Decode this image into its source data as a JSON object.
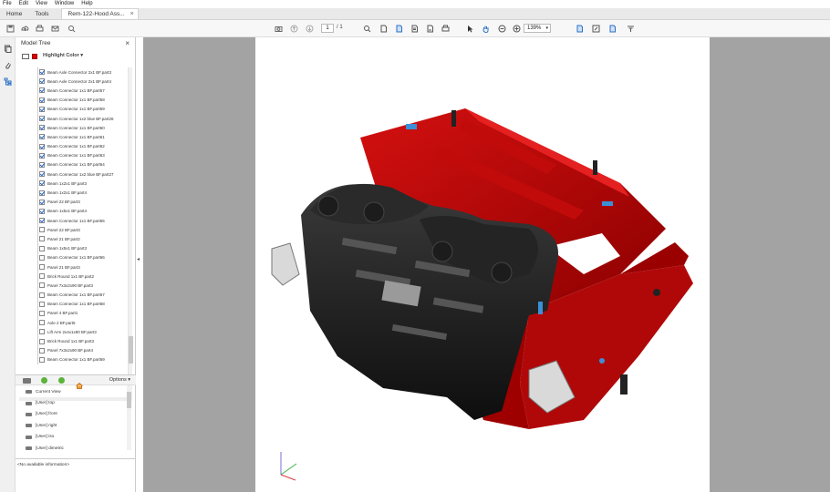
{
  "menu": [
    "File",
    "Edit",
    "View",
    "Window",
    "Help"
  ],
  "tabs": {
    "home": "Home",
    "tools": "Tools",
    "document": "Rem-122-Hood Ass..."
  },
  "toolbar": {
    "page_current": "1",
    "page_total": "/ 1",
    "zoom": "139%"
  },
  "model_tree": {
    "title": "Model Tree",
    "highlight_label": "Highlight Color",
    "highlight_color": "#e00000",
    "items": [
      {
        "label": "Beam Axle Connector 2x1 BF.part3",
        "checked": true
      },
      {
        "label": "Beam Axle Connector 2x1 BF.part4",
        "checked": true
      },
      {
        "label": "Beam Connector 1x1 BF.part57",
        "checked": true
      },
      {
        "label": "Beam Connector 1x1 BF.part58",
        "checked": true
      },
      {
        "label": "Beam Connector 1x1 BF.part59",
        "checked": true
      },
      {
        "label": "Beam Connector 1x2 blue BF.part26",
        "checked": true
      },
      {
        "label": "Beam Connector 1x1 BF.part60",
        "checked": true
      },
      {
        "label": "Beam Connector 1x1 BF.part61",
        "checked": true
      },
      {
        "label": "Beam Connector 1x1 BF.part62",
        "checked": true
      },
      {
        "label": "Beam Connector 1x1 BF.part63",
        "checked": true
      },
      {
        "label": "Beam Connector 1x1 BF.part64",
        "checked": true
      },
      {
        "label": "Beam Connector 1x2 blue BF.part27",
        "checked": true
      },
      {
        "label": "Beam 1x2x1 BF.part3",
        "checked": true
      },
      {
        "label": "Beam 1x2x1 BF.part4",
        "checked": true
      },
      {
        "label": "Panel 22 BF.part3",
        "checked": true
      },
      {
        "label": "Beam 1x5x1 BF.part4",
        "checked": true
      },
      {
        "label": "Beam Connector 1x1 BF.part65",
        "checked": true
      },
      {
        "label": "Panel 22 BF.part3",
        "checked": false
      },
      {
        "label": "Panel 21 BF.part2",
        "checked": false
      },
      {
        "label": "Beam 1x5x1 BF.part3",
        "checked": false
      },
      {
        "label": "Beam Connector 1x1 BF.part66",
        "checked": false
      },
      {
        "label": "Panel 21 BF.part3",
        "checked": false
      },
      {
        "label": "Brick Round 1x1 BF.part2",
        "checked": false
      },
      {
        "label": "Panel 7x3x2x90 BF.part3",
        "checked": false
      },
      {
        "label": "Beam Connector 1x1 BF.part67",
        "checked": false
      },
      {
        "label": "Beam Connector 1x1 BF.part68",
        "checked": false
      },
      {
        "label": "Panel 4 BF.part1",
        "checked": false
      },
      {
        "label": "Axle 2 BF.part5",
        "checked": false
      },
      {
        "label": "Lift Arm 2x4x1x90 BF.part3",
        "checked": false
      },
      {
        "label": "Brick Round 1x1 BF.part3",
        "checked": false
      },
      {
        "label": "Panel 7x3x2x90 BF.part4",
        "checked": false
      },
      {
        "label": "Beam Connector 1x1 BF.part69",
        "checked": false
      }
    ]
  },
  "views": {
    "options_label": "Options",
    "items": [
      "Current View",
      "[User] top",
      "[User] front",
      "[User] right",
      "[User] iso",
      "[User] dimetric"
    ]
  },
  "info_text": "<No available information>"
}
